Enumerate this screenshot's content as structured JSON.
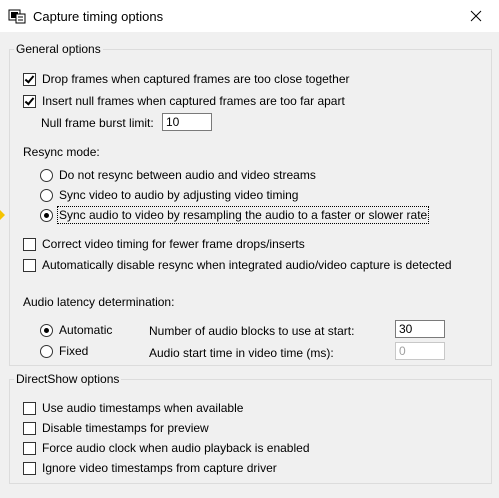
{
  "window": {
    "title": "Capture timing options",
    "close_icon": "close-icon",
    "app_icon": "capture-app-icon"
  },
  "general": {
    "legend": "General options",
    "drop_frames": {
      "label": "Drop frames when captured frames are too close together",
      "checked": true
    },
    "insert_null": {
      "label": "Insert null frames when captured frames are too far apart",
      "checked": true
    },
    "burst_limit": {
      "label": "Null frame burst limit:",
      "value": "10"
    },
    "resync_label": "Resync mode:",
    "resync_options": [
      {
        "label": "Do not resync between audio and video streams",
        "selected": false
      },
      {
        "label": "Sync video to audio by adjusting video timing",
        "selected": false
      },
      {
        "label": "Sync audio to video by resampling the audio to a faster or slower rate",
        "selected": true
      }
    ],
    "correct_timing": {
      "label": "Correct video timing for fewer frame drops/inserts",
      "checked": false
    },
    "auto_disable": {
      "label": "Automatically disable resync when integrated audio/video capture is detected",
      "checked": false
    },
    "latency_label": "Audio latency determination:",
    "latency_automatic": {
      "label": "Automatic",
      "selected": true
    },
    "latency_fixed": {
      "label": "Fixed",
      "selected": false
    },
    "blocks_label": "Number of audio blocks to use at start:",
    "blocks_value": "30",
    "start_time_label": "Audio start time in video time (ms):",
    "start_time_value": "0"
  },
  "directshow": {
    "legend": "DirectShow options",
    "options": [
      {
        "label": "Use audio timestamps when available",
        "checked": false
      },
      {
        "label": "Disable timestamps for preview",
        "checked": false
      },
      {
        "label": "Force audio clock when audio playback is enabled",
        "checked": false
      },
      {
        "label": "Ignore video timestamps from capture driver",
        "checked": false
      }
    ]
  },
  "colors": {
    "background": "#f0f0f0",
    "titlebar": "#ffffff",
    "group_border": "#dcdcdc",
    "marker": "#f5c400"
  }
}
